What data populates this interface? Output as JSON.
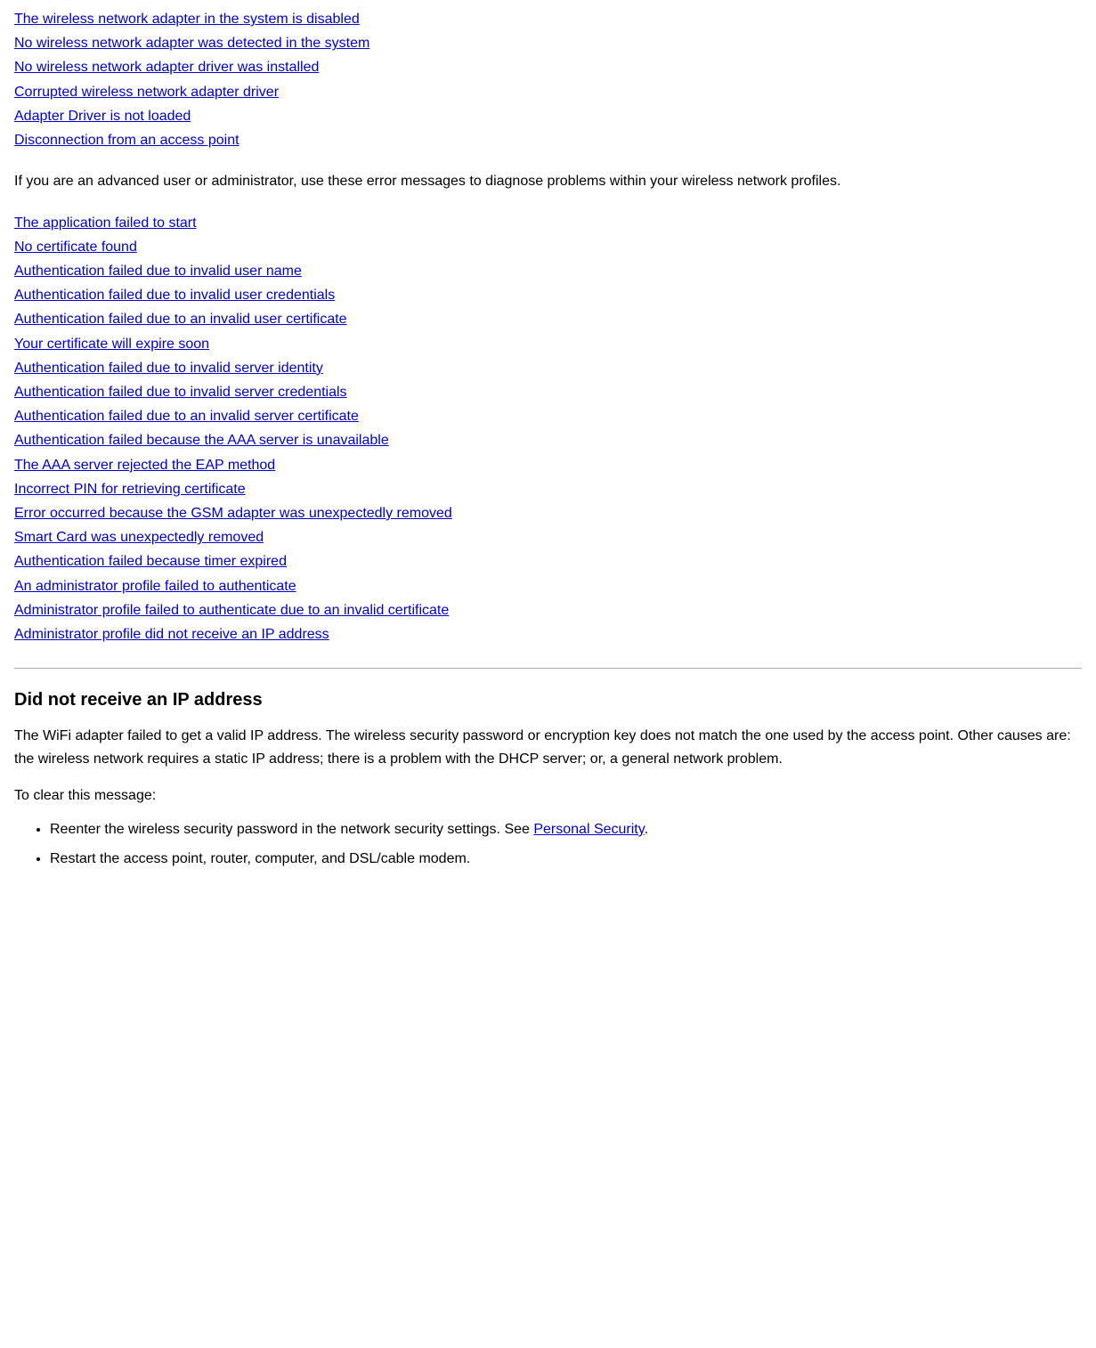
{
  "nav_links": [
    {
      "label": "The wireless network adapter in the system is disabled",
      "id": "link-adapter-disabled"
    },
    {
      "label": "No wireless network adapter was detected in the system",
      "id": "link-adapter-not-detected"
    },
    {
      "label": "No wireless network adapter driver was installed",
      "id": "link-no-driver-installed"
    },
    {
      "label": "Corrupted wireless network adapter driver",
      "id": "link-corrupted-driver"
    },
    {
      "label": "Adapter Driver is not loaded",
      "id": "link-driver-not-loaded"
    },
    {
      "label": "Disconnection from an access point",
      "id": "link-disconnection"
    }
  ],
  "intro_text": "If you are an advanced user or administrator, use these error messages to diagnose problems within your wireless network profiles.",
  "error_links": [
    {
      "label": "The application failed to start",
      "id": "link-app-failed"
    },
    {
      "label": "No certificate found",
      "id": "link-no-cert"
    },
    {
      "label": "Authentication failed due to invalid user name",
      "id": "link-invalid-username"
    },
    {
      "label": "Authentication failed due to invalid user credentials",
      "id": "link-invalid-credentials"
    },
    {
      "label": "Authentication failed due to an invalid user certificate",
      "id": "link-invalid-user-cert"
    },
    {
      "label": "Your certificate will expire soon",
      "id": "link-cert-expire"
    },
    {
      "label": "Authentication failed due to invalid server identity",
      "id": "link-invalid-server-identity"
    },
    {
      "label": "Authentication failed due to invalid server credentials",
      "id": "link-invalid-server-credentials"
    },
    {
      "label": "Authentication failed due to an invalid server certificate",
      "id": "link-invalid-server-cert"
    },
    {
      "label": "Authentication failed because the AAA server is unavailable",
      "id": "link-aaa-unavailable"
    },
    {
      "label": "The AAA server rejected the EAP method",
      "id": "link-aaa-rejected-eap"
    },
    {
      "label": "Incorrect PIN for retrieving certificate",
      "id": "link-incorrect-pin"
    },
    {
      "label": "Error occurred because the GSM adapter was unexpectedly removed",
      "id": "link-gsm-removed"
    },
    {
      "label": "Smart Card was unexpectedly removed",
      "id": "link-smartcard-removed"
    },
    {
      "label": "Authentication failed because timer expired",
      "id": "link-timer-expired"
    },
    {
      "label": "An administrator profile failed to authenticate",
      "id": "link-admin-profile-failed"
    },
    {
      "label": "Administrator profile failed to authenticate due to an invalid certificate",
      "id": "link-admin-invalid-cert"
    },
    {
      "label": "Administrator profile did not receive an IP address",
      "id": "link-admin-no-ip"
    }
  ],
  "section": {
    "title": "Did not receive an IP address",
    "body": "The WiFi adapter failed to get a valid IP address. The wireless security password or encryption key does not match the one used by the access point. Other causes are: the wireless network requires a static IP address; there is a problem with the DHCP server; or, a general network problem.",
    "to_clear_label": "To clear this message:",
    "bullets": [
      {
        "text_before": "Reenter the wireless security password in the network security settings. See ",
        "link_label": "Personal Security",
        "text_after": "."
      },
      {
        "text_only": "Restart the access point, router, computer, and DSL/cable modem."
      }
    ]
  }
}
